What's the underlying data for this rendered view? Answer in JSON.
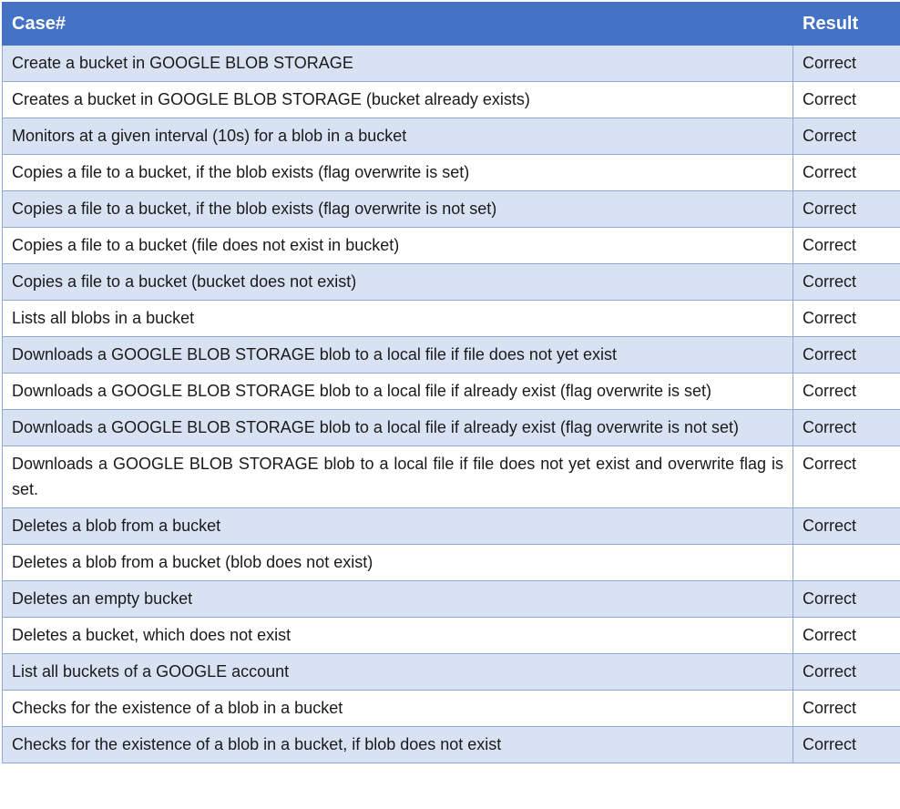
{
  "table": {
    "headers": {
      "case": "Case#",
      "result": "Result"
    },
    "rows": [
      {
        "case": "Create a bucket in GOOGLE BLOB STORAGE",
        "result": "Correct"
      },
      {
        "case": "Creates a bucket in GOOGLE BLOB STORAGE (bucket already exists)",
        "result": "Correct"
      },
      {
        "case": "Monitors at a given interval (10s) for a blob in a bucket",
        "result": "Correct"
      },
      {
        "case": "Copies a file to a bucket, if the blob exists (flag overwrite is set)",
        "result": "Correct"
      },
      {
        "case": "Copies a file to a bucket, if the blob exists (flag overwrite is not set)",
        "result": "Correct"
      },
      {
        "case": "Copies a file to a bucket (file does not exist in bucket)",
        "result": "Correct"
      },
      {
        "case": "Copies a file to a bucket (bucket does not exist)",
        "result": "Correct"
      },
      {
        "case": "Lists all blobs in a bucket",
        "result": "Correct"
      },
      {
        "case": "Downloads a GOOGLE BLOB STORAGE blob to a local file if file does not yet exist",
        "result": "Correct"
      },
      {
        "case": "Downloads a GOOGLE BLOB STORAGE blob to a local file if already exist (flag overwrite is set)",
        "result": "Correct"
      },
      {
        "case": "Downloads a GOOGLE BLOB STORAGE blob to a local file if already exist (flag overwrite is not set)",
        "result": "Correct"
      },
      {
        "case": "Downloads a GOOGLE BLOB STORAGE blob to a local file if file does not yet exist and overwrite flag is set.",
        "result": "Correct"
      },
      {
        "case": "Deletes a blob from a bucket",
        "result": "Correct"
      },
      {
        "case": "Deletes a blob from a bucket (blob does not exist)",
        "result": ""
      },
      {
        "case": "Deletes an empty bucket",
        "result": "Correct"
      },
      {
        "case": "Deletes a bucket, which does not exist",
        "result": "Correct"
      },
      {
        "case": "List all buckets of a GOOGLE account",
        "result": "Correct"
      },
      {
        "case": "Checks for the existence of a blob in a bucket",
        "result": "Correct"
      },
      {
        "case": "Checks for the existence of a blob in a bucket, if blob does not exist",
        "result": "Correct"
      }
    ]
  },
  "colors": {
    "header_bg": "#4472c4",
    "header_text": "#ffffff",
    "band_bg": "#d9e2f3",
    "border": "#8eaadb"
  }
}
